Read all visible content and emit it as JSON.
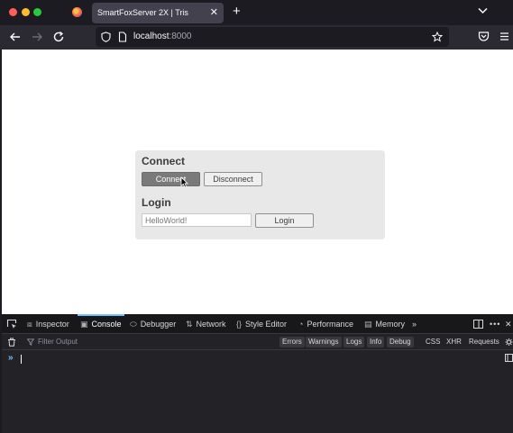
{
  "browser": {
    "tab_title": "SmartFoxServer 2X | Tris",
    "tab_close": "✕",
    "new_tab": "+",
    "url_host": "localhost",
    "url_port": ":8000"
  },
  "page": {
    "connect_heading": "Connect",
    "connect_button": "Connect",
    "disconnect_button": "Disconnect",
    "login_heading": "Login",
    "login_input_placeholder": "HelloWorld!",
    "login_button": "Login"
  },
  "devtools": {
    "tabs": [
      {
        "label": "Inspector",
        "icon": "inspector-icon"
      },
      {
        "label": "Console",
        "icon": "console-icon",
        "selected": true
      },
      {
        "label": "Debugger",
        "icon": "debugger-icon"
      },
      {
        "label": "Network",
        "icon": "network-icon"
      },
      {
        "label": "Style Editor",
        "icon": "style-editor-icon"
      },
      {
        "label": "Performance",
        "icon": "performance-icon"
      },
      {
        "label": "Memory",
        "icon": "memory-icon"
      }
    ],
    "filter_placeholder": "Filter Output",
    "filter_chips": [
      "Errors",
      "Warnings",
      "Logs",
      "Info",
      "Debug"
    ],
    "filter_plain": [
      "CSS",
      "XHR",
      "Requests"
    ],
    "prompt_symbol": "»"
  },
  "colors": {
    "accent": "#75bfff",
    "connect_active": "#7a7a7a"
  }
}
